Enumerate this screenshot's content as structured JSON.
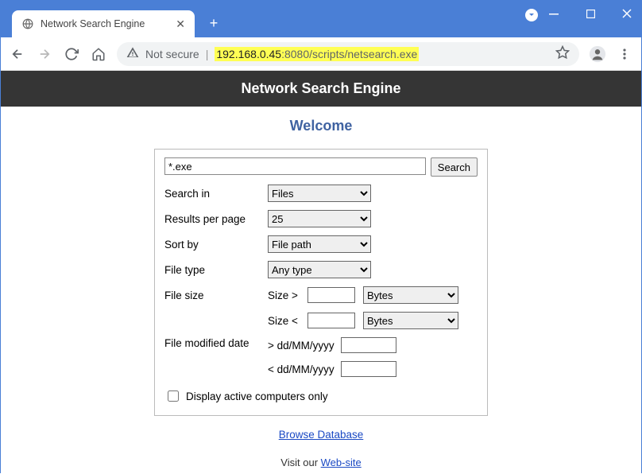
{
  "browser": {
    "tab_title": "Network Search Engine",
    "not_secure": "Not secure",
    "url_ip": "192.168.0.45",
    "url_rest": ":8080/scripts/netsearch.exe"
  },
  "page": {
    "banner": "Network Search Engine",
    "welcome": "Welcome",
    "search_value": "*.exe",
    "search_button": "Search",
    "labels": {
      "search_in": "Search in",
      "results_per_page": "Results per page",
      "sort_by": "Sort by",
      "file_type": "File type",
      "file_size": "File size",
      "file_modified": "File modified date",
      "size_gt": "Size >",
      "size_lt": "Size <",
      "date_gt": "> dd/MM/yyyy",
      "date_lt": "< dd/MM/yyyy",
      "active_only": "Display active computers only"
    },
    "selects": {
      "search_in": "Files",
      "results_per_page": "25",
      "sort_by": "File path",
      "file_type": "Any type",
      "bytes": "Bytes"
    },
    "links": {
      "browse": "Browse Database",
      "visit_pre": "Visit our ",
      "visit_link": "Web-site"
    }
  }
}
